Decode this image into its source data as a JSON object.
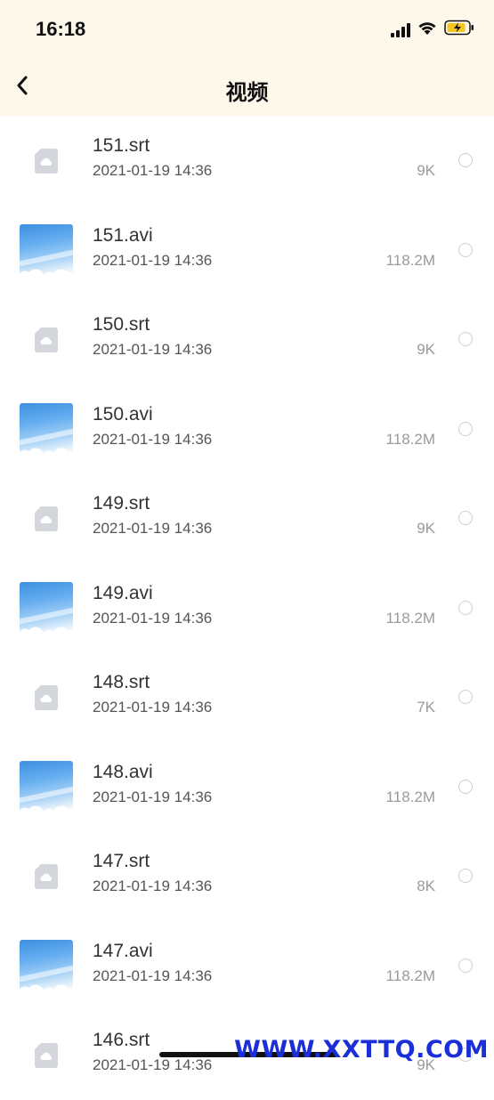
{
  "status_bar": {
    "time": "16:18",
    "icons": [
      "signal-icon",
      "wifi-icon",
      "battery-charging-icon"
    ],
    "battery_color": "#f3c623"
  },
  "nav": {
    "back_icon": "chevron-left-icon",
    "title": "视频"
  },
  "files": [
    {
      "name": "151.srt",
      "date": "2021-01-19 14:36",
      "size": "9K",
      "kind": "subtitle"
    },
    {
      "name": "151.avi",
      "date": "2021-01-19 14:36",
      "size": "118.2M",
      "kind": "video"
    },
    {
      "name": "150.srt",
      "date": "2021-01-19 14:36",
      "size": "9K",
      "kind": "subtitle"
    },
    {
      "name": "150.avi",
      "date": "2021-01-19 14:36",
      "size": "118.2M",
      "kind": "video"
    },
    {
      "name": "149.srt",
      "date": "2021-01-19 14:36",
      "size": "9K",
      "kind": "subtitle"
    },
    {
      "name": "149.avi",
      "date": "2021-01-19 14:36",
      "size": "118.2M",
      "kind": "video"
    },
    {
      "name": "148.srt",
      "date": "2021-01-19 14:36",
      "size": "7K",
      "kind": "subtitle"
    },
    {
      "name": "148.avi",
      "date": "2021-01-19 14:36",
      "size": "118.2M",
      "kind": "video"
    },
    {
      "name": "147.srt",
      "date": "2021-01-19 14:36",
      "size": "8K",
      "kind": "subtitle"
    },
    {
      "name": "147.avi",
      "date": "2021-01-19 14:36",
      "size": "118.2M",
      "kind": "video"
    },
    {
      "name": "146.srt",
      "date": "2021-01-19 14:36",
      "size": "9K",
      "kind": "subtitle"
    }
  ],
  "watermark": "WWW.XXTTQ.COM",
  "colors": {
    "header_background": "#fdf8e9",
    "watermark": "#1a2fd8"
  }
}
